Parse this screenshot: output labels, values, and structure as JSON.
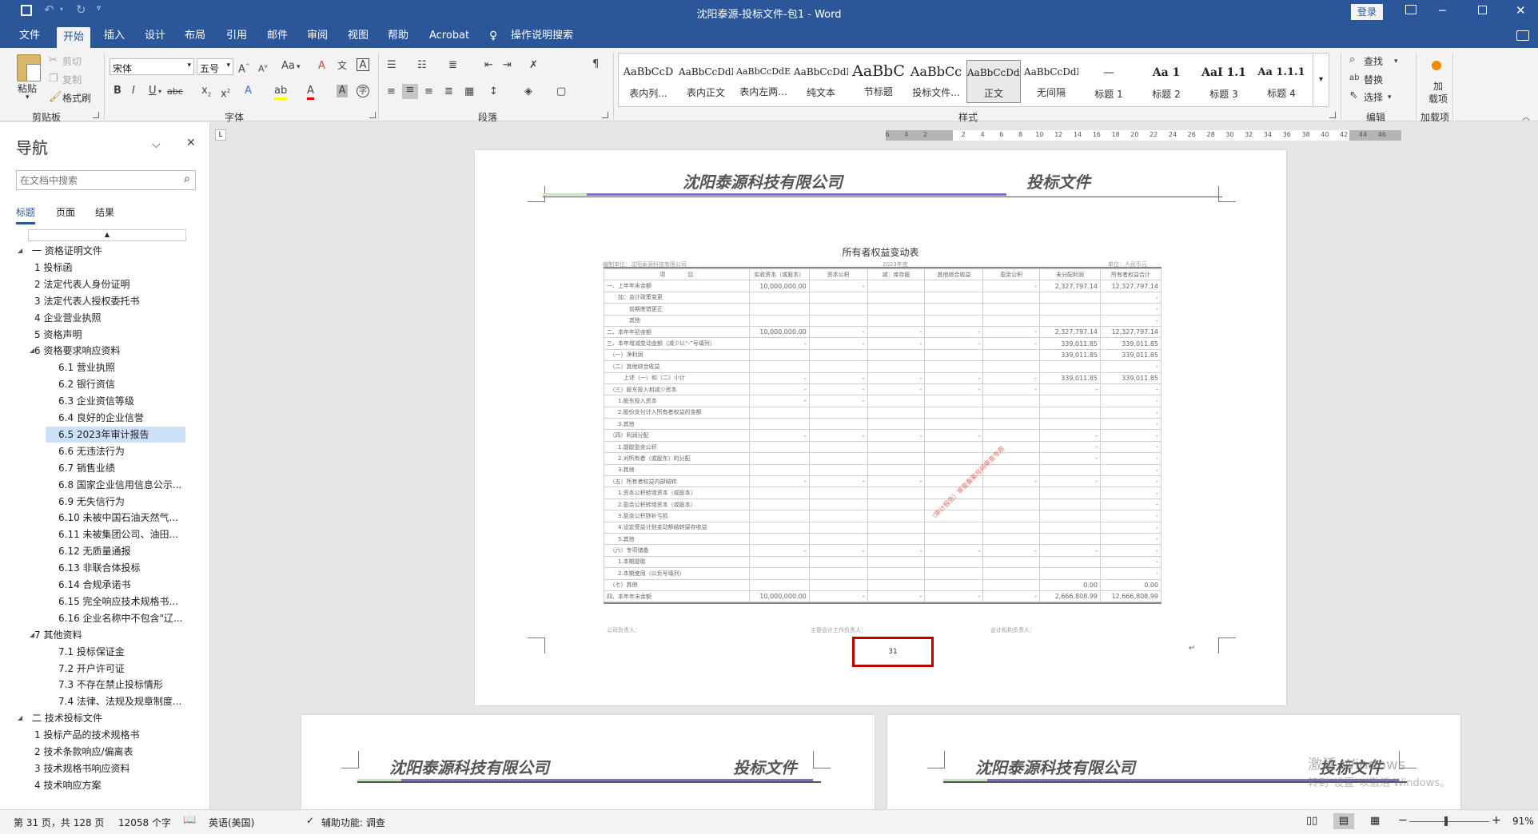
{
  "window": {
    "title": "沈阳泰源-投标文件-包1  -  Word",
    "login": "登录"
  },
  "tabs": [
    "文件",
    "开始",
    "插入",
    "设计",
    "布局",
    "引用",
    "邮件",
    "审阅",
    "视图",
    "帮助",
    "Acrobat",
    "操作说明搜索"
  ],
  "active_tab": "开始",
  "clipboard": {
    "paste": "粘贴",
    "cut": "剪切",
    "copy": "复制",
    "painter": "格式刷",
    "label": "剪贴板"
  },
  "font": {
    "name": "宋体",
    "size": "五号",
    "label": "字体",
    "aa": "Aa"
  },
  "paragraph": {
    "label": "段落"
  },
  "styles": {
    "label": "样式",
    "items": [
      {
        "preview": "AaBbCcD",
        "name": "表内列..."
      },
      {
        "preview": "AaBbCcDdI",
        "name": "表内正文"
      },
      {
        "preview": "AaBbCcDdEe",
        "name": "表内左两..."
      },
      {
        "preview": "AaBbCcDdI",
        "name": "纯文本"
      },
      {
        "preview": "AaBbC",
        "name": "节标题"
      },
      {
        "preview": "AaBbCc",
        "name": "投标文件..."
      },
      {
        "preview": "AaBbCcDdI",
        "name": "正文"
      },
      {
        "preview": "AaBbCcDdI",
        "name": "无间隔"
      },
      {
        "preview": "—",
        "name": "标题 1"
      },
      {
        "preview": "Aa  1",
        "name": "标题 2"
      },
      {
        "preview": "AaI  1.1",
        "name": "标题 3"
      },
      {
        "preview": "Aa  1.1.1",
        "name": "标题 4"
      }
    ]
  },
  "editing": {
    "find": "查找",
    "replace": "替换",
    "select": "选择",
    "label": "编辑"
  },
  "addins": {
    "button": "加\n载项",
    "label": "加载项"
  },
  "ruler_ticks": [
    "6",
    "4",
    "2",
    "",
    "2",
    "4",
    "6",
    "8",
    "10",
    "12",
    "14",
    "16",
    "18",
    "20",
    "22",
    "24",
    "26",
    "28",
    "30",
    "32",
    "34",
    "36",
    "38",
    "40",
    "42",
    "44",
    "46"
  ],
  "nav": {
    "title": "导航",
    "search_placeholder": "在文档中搜索",
    "tabs": [
      "标题",
      "页面",
      "结果"
    ],
    "items": [
      {
        "text": "一 资格证明文件",
        "level": 0,
        "expander": "◢"
      },
      {
        "text": "1 投标函",
        "level": 1
      },
      {
        "text": "2 法定代表人身份证明",
        "level": 1
      },
      {
        "text": "3 法定代表人授权委托书",
        "level": 1
      },
      {
        "text": "4 企业营业执照",
        "level": 1
      },
      {
        "text": "5 资格声明",
        "level": 1
      },
      {
        "text": "6 资格要求响应资料",
        "level": 1,
        "expander": "◢"
      },
      {
        "text": "6.1 营业执照",
        "level": 2
      },
      {
        "text": "6.2 银行资信",
        "level": 2
      },
      {
        "text": "6.3 企业资信等级",
        "level": 2
      },
      {
        "text": "6.4 良好的企业信誉",
        "level": 2
      },
      {
        "text": "6.5 2023年审计报告",
        "level": 2,
        "selected": true
      },
      {
        "text": "6.6 无违法行为",
        "level": 2
      },
      {
        "text": "6.7 销售业绩",
        "level": 2
      },
      {
        "text": "6.8 国家企业信用信息公示...",
        "level": 2
      },
      {
        "text": "6.9 无失信行为",
        "level": 2
      },
      {
        "text": "6.10 未被中国石油天然气...",
        "level": 2
      },
      {
        "text": "6.11 未被集团公司、油田...",
        "level": 2
      },
      {
        "text": "6.12 无质量通报",
        "level": 2
      },
      {
        "text": "6.13 非联合体投标",
        "level": 2
      },
      {
        "text": "6.14 合规承诺书",
        "level": 2
      },
      {
        "text": "6.15 完全响应技术规格书...",
        "level": 2
      },
      {
        "text": "6.16 企业名称中不包含\"辽...",
        "level": 2
      },
      {
        "text": "7 其他资料",
        "level": 1,
        "expander": "◢"
      },
      {
        "text": "7.1 投标保证金",
        "level": 2
      },
      {
        "text": "7.2 开户许可证",
        "level": 2
      },
      {
        "text": "7.3 不存在禁止投标情形",
        "level": 2
      },
      {
        "text": "7.4 法律、法规及规章制度...",
        "level": 2
      },
      {
        "text": "二 技术投标文件",
        "level": 0,
        "expander": "◢"
      },
      {
        "text": "1 投标产品的技术规格书",
        "level": 1
      },
      {
        "text": "2 技术条款响应/偏离表",
        "level": 1
      },
      {
        "text": "3 技术规格书响应资料",
        "level": 1
      },
      {
        "text": "4 技术响应方案",
        "level": 1
      }
    ]
  },
  "document": {
    "header_company": "沈阳泰源科技有限公司",
    "header_doc": "投标文件",
    "table_title": "所有者权益变动表",
    "unit_left": "编制单位：沈阳泰源科技有限公司",
    "unit_mid": "2023年度",
    "unit_right": "单位：人民币元",
    "columns": [
      "项　　　　目",
      "实收资本（或股本）",
      "资本公积",
      "减：库存股",
      "其他综合收益",
      "盈余公积",
      "未分配利润",
      "所有者权益合计"
    ],
    "rows": [
      [
        "一、上年年末余额",
        "10,000,000.00",
        "-",
        "",
        "",
        "-",
        "2,327,797.14",
        "12,327,797.14"
      ],
      [
        "　　加：会计政策变更",
        "",
        "",
        "",
        "",
        "",
        "",
        "-"
      ],
      [
        "　　　　前期差错更正",
        "",
        "",
        "",
        "",
        "",
        "",
        "-"
      ],
      [
        "　　　　其他",
        "",
        "",
        "",
        "",
        "",
        "",
        "-"
      ],
      [
        "二、本年年初余额",
        "10,000,000.00",
        "-",
        "-",
        "-",
        "-",
        "2,327,797.14",
        "12,327,797.14"
      ],
      [
        "三、本年增减变动金额（减少以“-”号填列）",
        "-",
        "-",
        "-",
        "-",
        "-",
        "339,011.85",
        "339,011.85"
      ],
      [
        "　（一）净利润",
        "",
        "",
        "",
        "",
        "",
        "339,011.85",
        "339,011.85"
      ],
      [
        "　（二）其他综合收益",
        "",
        "",
        "",
        "",
        "",
        "",
        "-"
      ],
      [
        "　　　上述（一）和（二）小计",
        "-",
        "-",
        "-",
        "-",
        "-",
        "339,011.85",
        "339,011.85"
      ],
      [
        "　（三）股东投入和减少资本",
        "-",
        "-",
        "-",
        "-",
        "-",
        "-",
        "-"
      ],
      [
        "　　1.股东投入资本",
        "-",
        "-",
        "",
        "",
        "",
        "",
        "-"
      ],
      [
        "　　2.股份支付计入所有者权益的金额",
        "",
        "",
        "",
        "",
        "",
        "",
        "-"
      ],
      [
        "　　3.其他",
        "",
        "",
        "",
        "",
        "",
        "",
        "-"
      ],
      [
        "　（四）利润分配",
        "-",
        "-",
        "-",
        "-",
        "",
        "-",
        "-"
      ],
      [
        "　　1.提取盈余公积",
        "",
        "",
        "",
        "",
        "",
        "-",
        "-"
      ],
      [
        "　　2.对所有者（或股东）的分配",
        "",
        "",
        "",
        "",
        "",
        "-",
        "-"
      ],
      [
        "　　3.其他",
        "",
        "",
        "",
        "",
        "",
        "",
        "-"
      ],
      [
        "　（五）所有者权益内部结转",
        "-",
        "-",
        "-",
        "",
        "-",
        "-",
        "-"
      ],
      [
        "　　1.资本公积转增资本（或股本）",
        "",
        "",
        "",
        "",
        "",
        "",
        "-"
      ],
      [
        "　　2.盈余公积转增资本（或股本）",
        "",
        "",
        "",
        "",
        "",
        "",
        "-"
      ],
      [
        "　　3.盈余公积弥补亏损",
        "",
        "",
        "",
        "",
        "",
        "",
        "-"
      ],
      [
        "　　4.设定受益计划变动额结转留存收益",
        "",
        "",
        "",
        "",
        "",
        "",
        "-"
      ],
      [
        "　　5.其他",
        "",
        "",
        "",
        "",
        "",
        "",
        "-"
      ],
      [
        "　（六）专项储备",
        "-",
        "-",
        "-",
        "-",
        "-",
        "-",
        "-"
      ],
      [
        "　　1.本期提取",
        "",
        "",
        "",
        "",
        "",
        "",
        "-"
      ],
      [
        "　　2.本期使用（以负号填列）",
        "",
        "",
        "",
        "",
        "",
        "",
        "-"
      ],
      [
        "　（七）其他",
        "",
        "",
        "",
        "",
        "",
        "0.00",
        "0.00"
      ],
      [
        "四、本年年末余额",
        "10,000,000.00",
        "-",
        "-",
        "-",
        "-",
        "2,666,808.99",
        "12,666,808.99"
      ]
    ],
    "sign_1": "公司负责人：",
    "sign_2": "主管会计工作负责人：",
    "sign_3": "会计机构负责人：",
    "stamp_text": "（审计报告）审查备案号码审查专用",
    "page_number": "31",
    "activate_line1": "激活 Windows",
    "activate_line2": "转到\"设置\"以激活 Windows。"
  },
  "status": {
    "page": "第 31 页，共 128 页",
    "words": "12058 个字",
    "lang": "英语(美国)",
    "access": "辅助功能: 调查",
    "zoom": "91%"
  },
  "colors": {
    "accent": "#2b579a",
    "nav_selected": "#cce0f7",
    "highlight_box": "#c00000"
  }
}
